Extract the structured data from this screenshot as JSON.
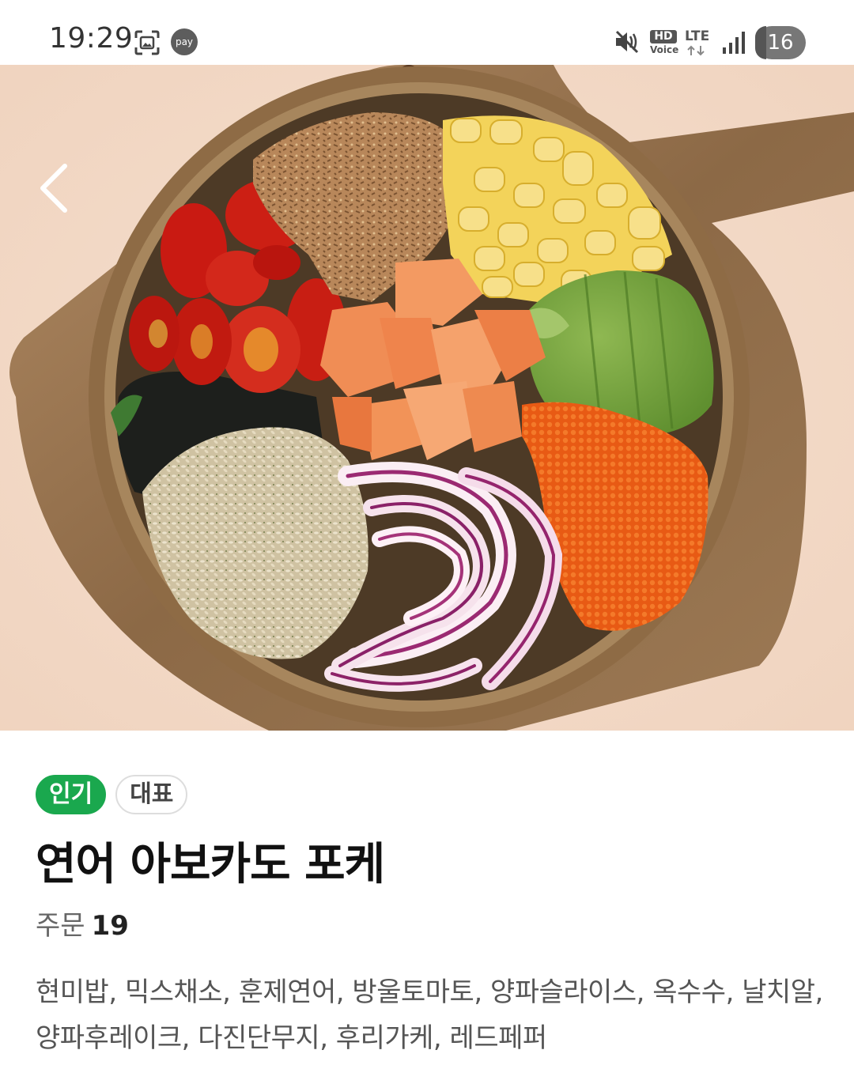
{
  "status_bar": {
    "time": "19:29",
    "pay_label": "pay",
    "hd_label": "HD",
    "voice_label": "Voice",
    "network_label": "LTE",
    "battery": "16",
    "battery_level_percent": 16,
    "icons": [
      "screenshot-icon",
      "pay-icon",
      "mute-icon",
      "hd-voice-icon",
      "lte-icon",
      "signal-icon",
      "battery-icon"
    ]
  },
  "hero": {
    "back_icon": "chevron-left-icon",
    "image_subject": "poke-bowl-photo"
  },
  "product": {
    "badges": [
      "인기",
      "대표"
    ],
    "title": "연어 아보카도 포케",
    "order_label": "주문",
    "order_count": "19",
    "description": "현미밥, 믹스채소, 훈제연어, 방울토마토, 양파슬라이스, 옥수수, 날치알, 양파후레이크, 다진단무지, 후리가케, 레드페퍼"
  },
  "colors": {
    "popular_badge": "#1aa84e",
    "background": "#ffffff",
    "photo_background": "#f3d9c5"
  }
}
